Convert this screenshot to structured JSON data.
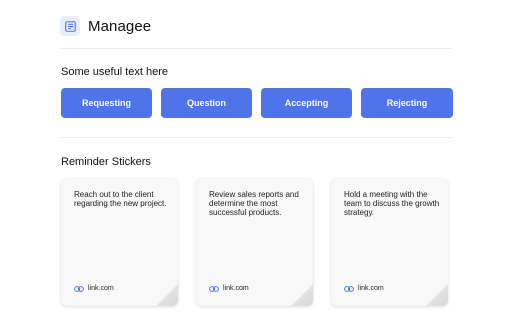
{
  "app": {
    "title": "Managee",
    "logo_icon": "document-grid-icon",
    "accent": "#4f74ea"
  },
  "actions": {
    "heading": "Some useful text here",
    "buttons": [
      {
        "label": "Requesting"
      },
      {
        "label": "Question"
      },
      {
        "label": "Accepting"
      },
      {
        "label": "Rejecting"
      }
    ]
  },
  "reminders": {
    "heading": "Reminder Stickers",
    "stickers": [
      {
        "text": "Reach out to the client regarding the new project.",
        "link_text": "link.com",
        "link_icon": "link-icon"
      },
      {
        "text": "Review sales reports and determine the most successful products.",
        "link_text": "link.com",
        "link_icon": "link-icon"
      },
      {
        "text": "Hold a meeting with the team to discuss the growth strategy.",
        "link_text": "link.com",
        "link_icon": "link-icon"
      }
    ]
  }
}
